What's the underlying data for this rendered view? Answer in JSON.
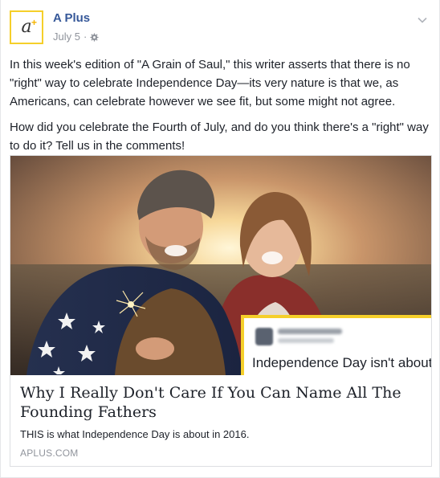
{
  "post": {
    "page_name": "A Plus",
    "date": "July 5",
    "separator": "·",
    "avatar_letter": "a",
    "avatar_plus": "+",
    "icons": {
      "audience": "globe-icon",
      "menu": "chevron-down-icon"
    }
  },
  "text": {
    "paragraph1": "In this week's edition of \"A Grain of Saul,\" this writer asserts that there is no \"right\" way to celebrate Independence Day—its very nature is that we, as Americans, can celebrate however we see fit, but some might not agree.",
    "paragraph2": "How did you celebrate the Fourth of July, and do you think there's a \"right\" way to do it? Tell us in the comments!"
  },
  "link_card": {
    "overlay_text": "Independence Day isn't about",
    "title": "Why I Really Don't Care If You Can Name All The Founding Fathers",
    "description": "THIS is what Independence Day is about in 2016.",
    "domain": "APLUS.COM"
  },
  "colors": {
    "link_blue": "#365899",
    "accent_yellow": "#f5cf2a",
    "muted": "#90949c"
  }
}
